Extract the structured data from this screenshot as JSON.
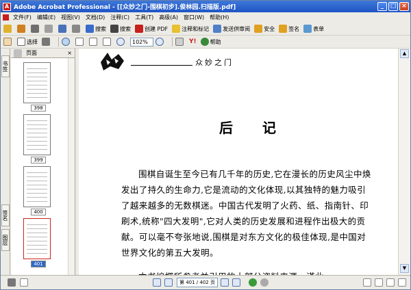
{
  "window": {
    "title": "Adobe Acrobat Professional - [[众妙之门-围棋初步].俊林园.扫描版.pdf]",
    "app_icon_letter": "A"
  },
  "menu": [
    "文件(F)",
    "编辑(E)",
    "视图(V)",
    "文档(D)",
    "注释(C)",
    "工具(T)",
    "高级(A)",
    "窗口(W)",
    "帮助(H)"
  ],
  "toolbar1": {
    "items": [
      {
        "name": "open",
        "label": "",
        "color": "#e0b030"
      },
      {
        "name": "create",
        "label": "",
        "color": "#d08020"
      },
      {
        "name": "print",
        "label": "",
        "color": "#6f6f6f"
      },
      {
        "name": "email",
        "label": "",
        "color": "#a0a0a0"
      },
      {
        "name": "organize",
        "label": "",
        "color": "#4a72b8"
      },
      {
        "name": "attach",
        "label": "",
        "color": "#888"
      },
      {
        "name": "search-web",
        "label": "搜索",
        "color": "#3a6bc8"
      },
      {
        "name": "binoculars",
        "label": "搜索",
        "color": "#444"
      },
      {
        "name": "create-pdf",
        "label": "创建 PDF",
        "color": "#c8201c"
      },
      {
        "name": "comment",
        "label": "注释和标记",
        "color": "#e8c030"
      },
      {
        "name": "send-review",
        "label": "发送供审阅",
        "color": "#5080c8"
      },
      {
        "name": "secure",
        "label": "安全",
        "color": "#e0a020"
      },
      {
        "name": "sign",
        "label": "签名",
        "color": "#e0a020"
      },
      {
        "name": "forms",
        "label": "表单",
        "color": "#5a9ad0"
      }
    ]
  },
  "toolbar2": {
    "select_label": "选择",
    "zoom_value": "102%",
    "help_label": "帮助"
  },
  "panel": {
    "tab_label": "页面",
    "nav_tabs": [
      "书签",
      "签名",
      "图层"
    ],
    "thumbs": [
      "398",
      "399",
      "400",
      "401"
    ]
  },
  "page": {
    "header": "众妙之门",
    "heading": "后 记",
    "paragraph": "围棋自诞生至今已有几千年的历史,它在漫长的历史风尘中焕发出了持久的生命力,它是流动的文化体现,以其独特的魅力吸引了越来越多的无数棋迷。中国古代发明了火药、纸、指南针、印刷术,统称\"四大发明\",它对人类的历史发展和进程作出极大的贡献。可以毫不夸张地说,围棋是对东方文化的极佳体现,是中国对世界文化的第五大发明。",
    "partial_line": "本书编撰所参考并引用的大部分资料来源，谨此"
  },
  "status": {
    "page_field": "第 401 / 402 页"
  }
}
